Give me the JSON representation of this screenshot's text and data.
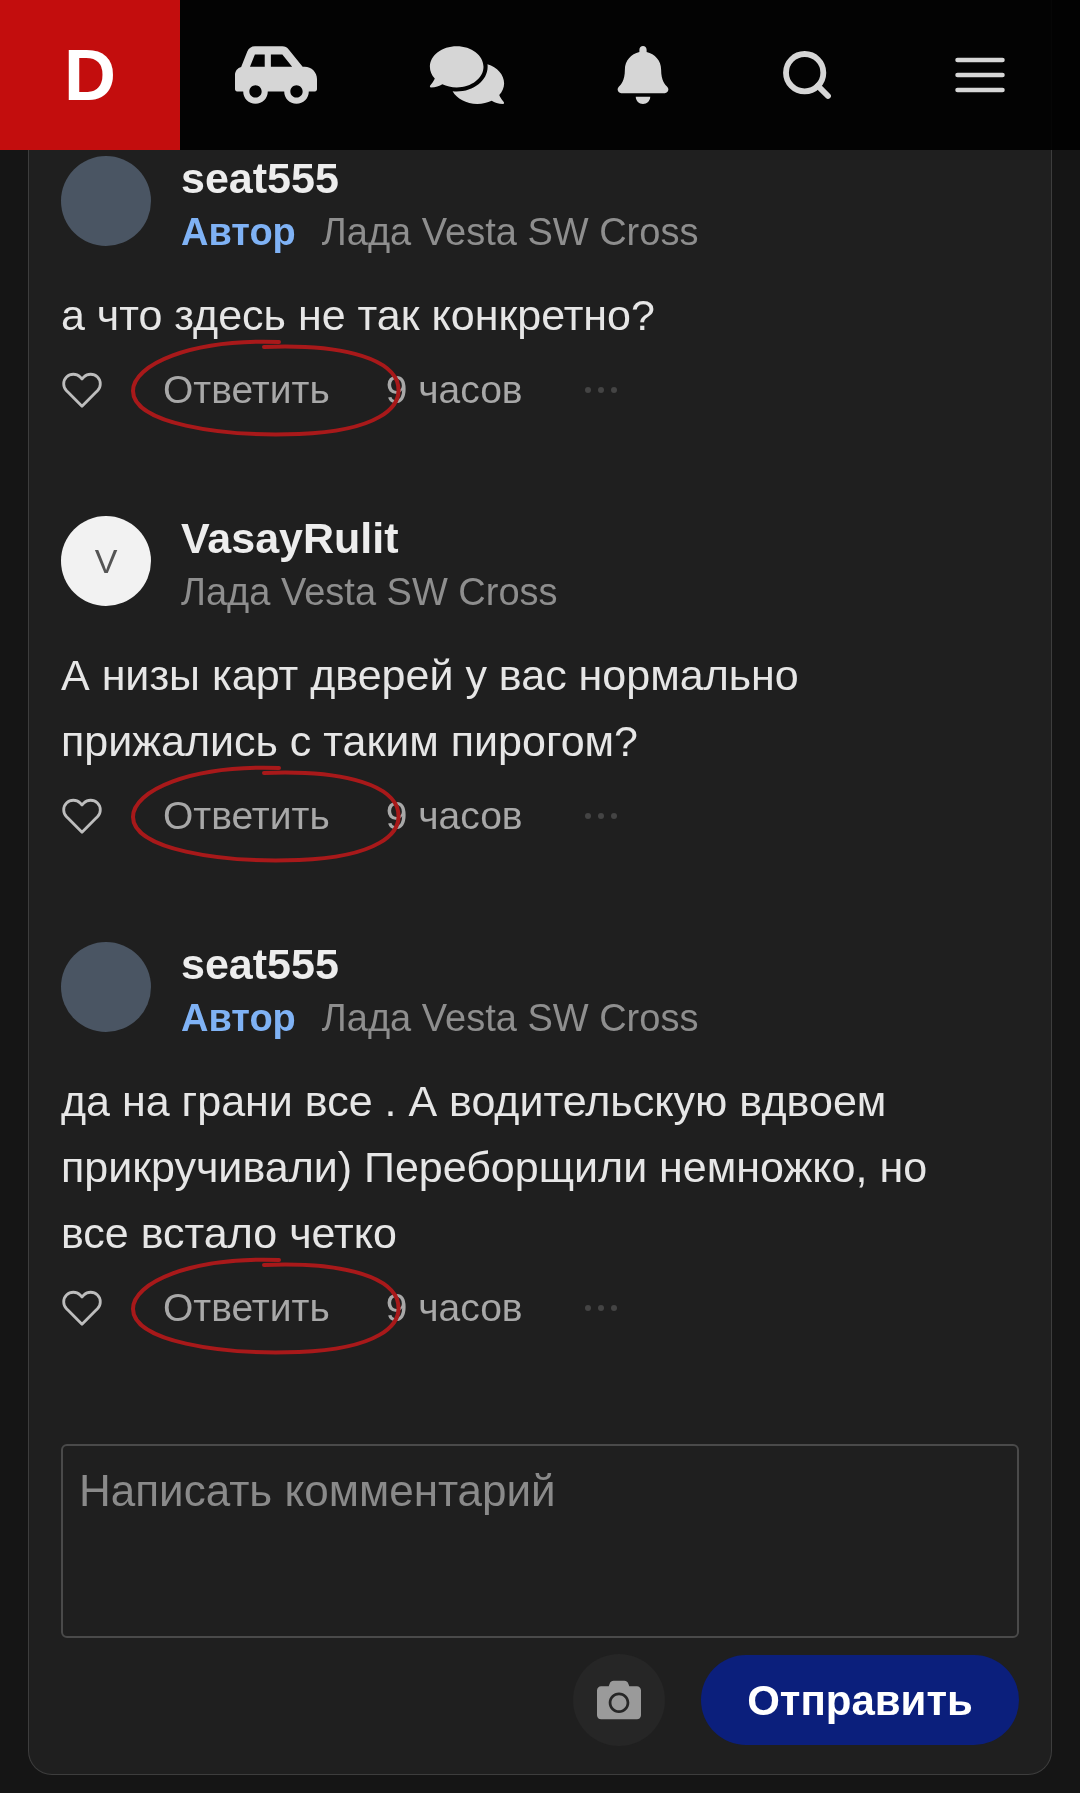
{
  "header": {
    "logo": "D"
  },
  "comments": [
    {
      "author": "seat555",
      "avatar": {
        "kind": "photo"
      },
      "badge": "Автор",
      "car": "Лада Vesta SW Cross",
      "text": "а что здесь не так конкретно?",
      "liked": false,
      "reply": "Ответить",
      "time": "9 часов",
      "annotated": true
    },
    {
      "author": "VasayRulit",
      "avatar": {
        "kind": "letter",
        "letter": "V"
      },
      "car": "Лада Vesta SW Cross",
      "text": "А низы карт дверей у вас нормально прижались с таким пирогом?",
      "liked": false,
      "reply": "Ответить",
      "time": "9 часов",
      "annotated": true
    },
    {
      "author": "seat555",
      "avatar": {
        "kind": "photo"
      },
      "badge": "Автор",
      "car": "Лада Vesta SW Cross",
      "text": "да на грани все . А водительскую вдвоем прикручивали) Переборщили немножко, но все встало четко",
      "liked": false,
      "reply": "Ответить",
      "time": "9 часов",
      "annotated": true
    }
  ],
  "composer": {
    "placeholder": "Написать комментарий",
    "send": "Отправить"
  }
}
